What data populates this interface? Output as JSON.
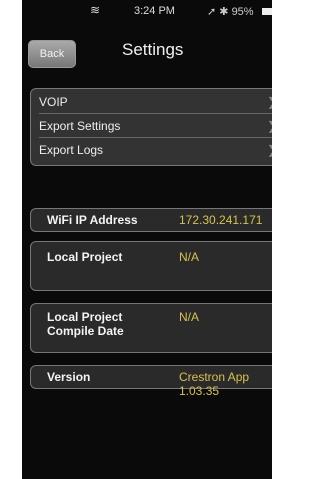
{
  "status_bar": {
    "time": "3:24 PM",
    "right_text": "95%"
  },
  "nav": {
    "back_label": "Back",
    "title": "Settings"
  },
  "menu": {
    "items": [
      {
        "label": "VOIP"
      },
      {
        "label": "Export Settings"
      },
      {
        "label": "Export Logs"
      }
    ]
  },
  "info": {
    "wifi": {
      "label": "WiFi IP Address",
      "value": "172.30.241.171"
    },
    "local_project": {
      "label": "Local Project",
      "value": "N/A"
    },
    "compile": {
      "label_line1": "Local Project",
      "label_line2": "Compile Date",
      "value": "N/A"
    },
    "version": {
      "label": "Version",
      "value": "Crestron App 1.03.35"
    }
  },
  "icons": {
    "wifi": "wifi-icon",
    "location": "location-arrow-icon",
    "bluetooth": "bluetooth-icon",
    "battery": "battery-icon",
    "chevron": "chevron-right-icon"
  },
  "colors": {
    "background": "#0a0a0a",
    "accent_value": "#d7c24a"
  }
}
